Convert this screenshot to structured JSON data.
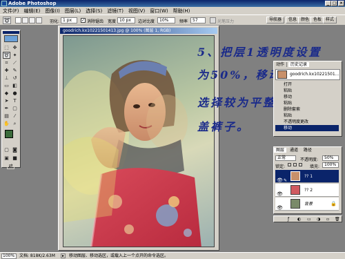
{
  "app": {
    "title": "Adobe Photoshop",
    "window_controls": [
      "_",
      "□",
      "×"
    ]
  },
  "menu": [
    "文件(F)",
    "编辑(E)",
    "图像(I)",
    "图层(L)",
    "选择(S)",
    "滤镜(T)",
    "视图(V)",
    "窗口(W)",
    "帮助(H)"
  ],
  "options": {
    "feather_label": "羽化:",
    "feather_value": "1 px",
    "antialias_label": "消除锯齿",
    "width_label": "宽度",
    "width_value": "10 px",
    "edge_contrast_label": "边对比度",
    "edge_contrast_value": "10%",
    "frequency_label": "频率",
    "frequency_value": "57",
    "pen_pressure_label": "光笔压力",
    "right_tabs": [
      "导航器",
      "信息",
      "颜色",
      "色板",
      "样式"
    ]
  },
  "document": {
    "title": "goodrich.kx10221501413.jpg @ 100% (图层 1, RGB)"
  },
  "annotation": {
    "line1": "5、把层1透明度设置",
    "line2": "为50%，移动图层，",
    "line3": "选择较为平整的布覆",
    "line4": "盖裤子。"
  },
  "history_panel": {
    "tabs": [
      "动作",
      "历史记录"
    ],
    "snapshot": "goodrich.kx10221501...",
    "items": [
      "打开",
      "粘贴",
      "移动",
      "粘贴",
      "删除套索",
      "粘贴",
      "不透明度更改",
      "移动"
    ],
    "active_index": 7
  },
  "layers_panel": {
    "tabs": [
      "图层",
      "通道",
      "路径"
    ],
    "blend_mode": "正常",
    "opacity_label": "不透明度:",
    "opacity_value": "50%",
    "lock_label": "锁定:",
    "fill_label": "填充:",
    "fill_value": "100%",
    "layers": [
      {
        "name": "?? 1",
        "selected": true
      },
      {
        "name": "?? 2",
        "selected": false
      },
      {
        "name": "背景",
        "selected": false
      }
    ]
  },
  "status": {
    "zoom": "100%",
    "doc_size": "文档: 818K/2.63M",
    "hint": "移动图层、移动选区，或载入上一个点开的命令选区。"
  },
  "colors": {
    "foreground": "#3b6b3b",
    "background": "#4a9a5a",
    "accent": "#0a246a",
    "annotation": "#1a2a8a"
  }
}
